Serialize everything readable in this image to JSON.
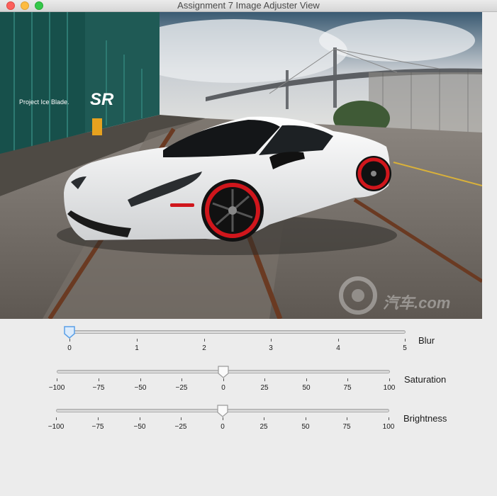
{
  "window": {
    "title": "Assignment 7 Image Adjuster View"
  },
  "image": {
    "overlay_text": "Project Ice Blade.",
    "logo_text": "SR",
    "watermark_text": "汽车.com"
  },
  "sliders": [
    {
      "name": "Blur",
      "min": 0,
      "max": 5,
      "value": 0,
      "tick_labels": [
        "0",
        "1",
        "2",
        "3",
        "4",
        "5"
      ]
    },
    {
      "name": "Saturation",
      "min": -100,
      "max": 100,
      "value": 0,
      "tick_labels": [
        "−100",
        "−75",
        "−50",
        "−25",
        "0",
        "25",
        "50",
        "75",
        "100"
      ]
    },
    {
      "name": "Brightness",
      "min": -100,
      "max": 100,
      "value": 0,
      "tick_labels": [
        "−100",
        "−75",
        "−50",
        "−25",
        "0",
        "25",
        "50",
        "75",
        "100"
      ]
    }
  ],
  "colors": {
    "close": "#fc605c",
    "minimize": "#fdbc40",
    "zoom": "#34c84a",
    "car_body": "#f2f2f2",
    "wheel_accent": "#d0161c",
    "active_thumb": "#5aa0e8"
  }
}
